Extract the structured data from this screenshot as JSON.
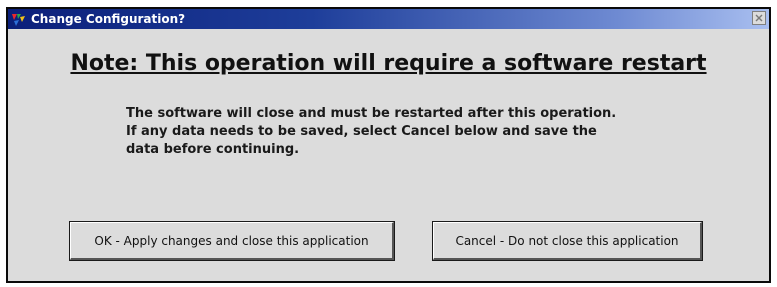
{
  "window": {
    "title": "Change Configuration?",
    "icon": "multicolor-app-icon",
    "close_icon": "close-icon"
  },
  "dialog": {
    "heading": "Note: This operation will require a software restart",
    "message_lines": [
      "The software will close and must be restarted after this operation.",
      "If any data needs to be saved, select Cancel below and save the",
      "data before continuing."
    ],
    "buttons": {
      "ok_label": "OK - Apply changes and close this application",
      "cancel_label": "Cancel - Do not close this application"
    }
  },
  "colors": {
    "titlebar_start": "#0b1f7a",
    "titlebar_end": "#a9bff0",
    "dialog_background": "#dcdcdc"
  }
}
